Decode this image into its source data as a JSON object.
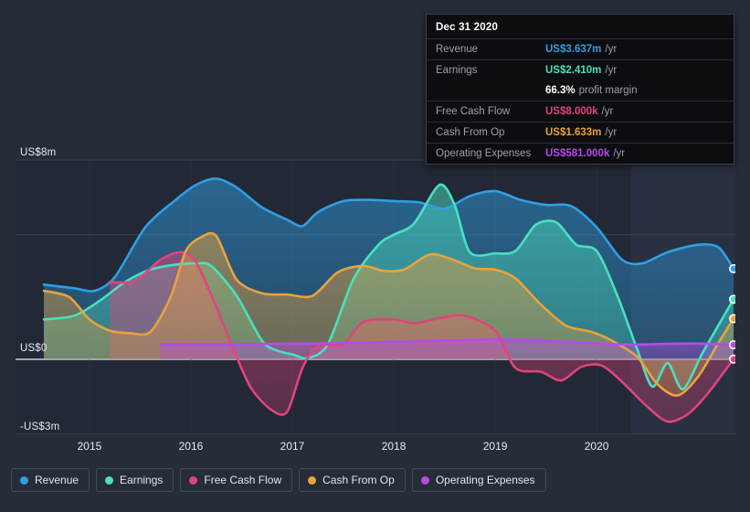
{
  "tooltip": {
    "title": "Dec 31 2020",
    "rows": [
      {
        "key": "Revenue",
        "value": "US$3.637m",
        "unit": "/yr",
        "color": "#2f9fe3"
      },
      {
        "key": "Earnings",
        "value": "US$2.410m",
        "unit": "/yr",
        "color": "#4ae0c0"
      },
      {
        "key": "",
        "value": "66.3%",
        "unit": "profit margin",
        "color": "#ffffff"
      },
      {
        "key": "Free Cash Flow",
        "value": "US$8.000k",
        "unit": "/yr",
        "color": "#e0447c"
      },
      {
        "key": "Cash From Op",
        "value": "US$1.633m",
        "unit": "/yr",
        "color": "#e8a33d"
      },
      {
        "key": "Operating Expenses",
        "value": "US$581.000k",
        "unit": "/yr",
        "color": "#b84ae8"
      }
    ]
  },
  "legend": {
    "items": [
      {
        "label": "Revenue",
        "color": "#2f9fe3"
      },
      {
        "label": "Earnings",
        "color": "#4ae0c0"
      },
      {
        "label": "Free Cash Flow",
        "color": "#e0447c"
      },
      {
        "label": "Cash From Op",
        "color": "#e8a33d"
      },
      {
        "label": "Operating Expenses",
        "color": "#b84ae8"
      }
    ]
  },
  "chart_data": {
    "type": "area",
    "title": "",
    "xlabel": "",
    "ylabel": "",
    "currency": "USD",
    "ylim": [
      -3,
      8
    ],
    "y_ticks": [
      {
        "label": "US$8m",
        "value": 8
      },
      {
        "label": "US$0",
        "value": 0
      },
      {
        "label": "-US$3m",
        "value": -3
      }
    ],
    "gridlines": [
      8,
      5,
      0,
      -3
    ],
    "x_ticks": [
      "2015",
      "2016",
      "2017",
      "2018",
      "2019",
      "2020"
    ],
    "x_range": [
      "2014-07",
      "2021-03"
    ],
    "grid": true,
    "legend_position": "bottom-left",
    "highlight_band": {
      "from": "2020-06",
      "to": "2021-03"
    },
    "series": [
      {
        "name": "Revenue",
        "color": "#2f9fe3",
        "end_value": 3.637,
        "points": [
          [
            2014.55,
            3.0
          ],
          [
            2014.85,
            2.85
          ],
          [
            2015.05,
            2.75
          ],
          [
            2015.25,
            3.3
          ],
          [
            2015.55,
            5.3
          ],
          [
            2015.85,
            6.4
          ],
          [
            2016.05,
            7.0
          ],
          [
            2016.25,
            7.25
          ],
          [
            2016.45,
            6.9
          ],
          [
            2016.7,
            6.1
          ],
          [
            2016.95,
            5.6
          ],
          [
            2017.1,
            5.35
          ],
          [
            2017.25,
            5.9
          ],
          [
            2017.5,
            6.35
          ],
          [
            2017.75,
            6.4
          ],
          [
            2018.0,
            6.35
          ],
          [
            2018.25,
            6.3
          ],
          [
            2018.5,
            6.05
          ],
          [
            2018.75,
            6.55
          ],
          [
            2019.0,
            6.75
          ],
          [
            2019.25,
            6.4
          ],
          [
            2019.5,
            6.2
          ],
          [
            2019.75,
            6.15
          ],
          [
            2020.0,
            5.3
          ],
          [
            2020.25,
            4.0
          ],
          [
            2020.45,
            3.85
          ],
          [
            2020.7,
            4.3
          ],
          [
            2021.0,
            4.6
          ],
          [
            2021.2,
            4.5
          ],
          [
            2021.35,
            3.637
          ]
        ]
      },
      {
        "name": "Earnings",
        "color": "#4ae0c0",
        "end_value": 2.41,
        "points": [
          [
            2014.55,
            1.6
          ],
          [
            2014.85,
            1.75
          ],
          [
            2015.1,
            2.35
          ],
          [
            2015.35,
            3.1
          ],
          [
            2015.6,
            3.6
          ],
          [
            2015.85,
            3.8
          ],
          [
            2016.05,
            3.85
          ],
          [
            2016.2,
            3.75
          ],
          [
            2016.45,
            2.55
          ],
          [
            2016.7,
            0.75
          ],
          [
            2016.85,
            0.35
          ],
          [
            2017.0,
            0.2
          ],
          [
            2017.15,
            0.05
          ],
          [
            2017.35,
            0.6
          ],
          [
            2017.6,
            3.2
          ],
          [
            2017.85,
            4.6
          ],
          [
            2018.0,
            5.0
          ],
          [
            2018.2,
            5.45
          ],
          [
            2018.45,
            7.0
          ],
          [
            2018.6,
            6.2
          ],
          [
            2018.75,
            4.3
          ],
          [
            2019.0,
            4.25
          ],
          [
            2019.2,
            4.35
          ],
          [
            2019.4,
            5.4
          ],
          [
            2019.6,
            5.5
          ],
          [
            2019.8,
            4.6
          ],
          [
            2020.0,
            4.35
          ],
          [
            2020.2,
            2.6
          ],
          [
            2020.4,
            0.4
          ],
          [
            2020.55,
            -1.1
          ],
          [
            2020.7,
            -0.15
          ],
          [
            2020.85,
            -1.2
          ],
          [
            2021.05,
            0.3
          ],
          [
            2021.35,
            2.41
          ]
        ]
      },
      {
        "name": "Free Cash Flow",
        "color": "#e0447c",
        "end_value": 0.008,
        "points": [
          [
            2015.2,
            3.1
          ],
          [
            2015.45,
            3.15
          ],
          [
            2015.7,
            4.0
          ],
          [
            2015.9,
            4.3
          ],
          [
            2016.05,
            3.9
          ],
          [
            2016.25,
            2.1
          ],
          [
            2016.45,
            0.1
          ],
          [
            2016.6,
            -1.2
          ],
          [
            2016.8,
            -2.05
          ],
          [
            2016.95,
            -2.1
          ],
          [
            2017.1,
            -0.35
          ],
          [
            2017.25,
            0.55
          ],
          [
            2017.5,
            0.6
          ],
          [
            2017.7,
            1.5
          ],
          [
            2018.0,
            1.6
          ],
          [
            2018.2,
            1.45
          ],
          [
            2018.45,
            1.65
          ],
          [
            2018.7,
            1.75
          ],
          [
            2019.0,
            1.15
          ],
          [
            2019.2,
            -0.35
          ],
          [
            2019.45,
            -0.5
          ],
          [
            2019.65,
            -0.85
          ],
          [
            2019.85,
            -0.3
          ],
          [
            2020.05,
            -0.25
          ],
          [
            2020.25,
            -0.9
          ],
          [
            2020.5,
            -1.9
          ],
          [
            2020.7,
            -2.5
          ],
          [
            2020.9,
            -2.2
          ],
          [
            2021.1,
            -1.35
          ],
          [
            2021.35,
            0.008
          ]
        ]
      },
      {
        "name": "Cash From Op",
        "color": "#e8a33d",
        "end_value": 1.633,
        "points": [
          [
            2014.55,
            2.75
          ],
          [
            2014.8,
            2.5
          ],
          [
            2015.0,
            1.6
          ],
          [
            2015.2,
            1.15
          ],
          [
            2015.4,
            1.05
          ],
          [
            2015.6,
            1.1
          ],
          [
            2015.8,
            2.5
          ],
          [
            2015.95,
            4.35
          ],
          [
            2016.1,
            4.9
          ],
          [
            2016.25,
            4.95
          ],
          [
            2016.45,
            3.2
          ],
          [
            2016.7,
            2.65
          ],
          [
            2016.95,
            2.6
          ],
          [
            2017.2,
            2.55
          ],
          [
            2017.45,
            3.5
          ],
          [
            2017.7,
            3.75
          ],
          [
            2017.9,
            3.55
          ],
          [
            2018.1,
            3.6
          ],
          [
            2018.35,
            4.2
          ],
          [
            2018.55,
            4.05
          ],
          [
            2018.8,
            3.65
          ],
          [
            2019.0,
            3.6
          ],
          [
            2019.2,
            3.25
          ],
          [
            2019.45,
            2.2
          ],
          [
            2019.7,
            1.35
          ],
          [
            2019.95,
            1.1
          ],
          [
            2020.15,
            0.75
          ],
          [
            2020.4,
            0.1
          ],
          [
            2020.6,
            -1.0
          ],
          [
            2020.8,
            -1.45
          ],
          [
            2021.0,
            -0.7
          ],
          [
            2021.2,
            0.65
          ],
          [
            2021.35,
            1.633
          ]
        ]
      },
      {
        "name": "Operating Expenses",
        "color": "#b84ae8",
        "end_value": 0.581,
        "points": [
          [
            2015.7,
            0.6
          ],
          [
            2016.0,
            0.6
          ],
          [
            2016.4,
            0.6
          ],
          [
            2016.8,
            0.62
          ],
          [
            2017.2,
            0.63
          ],
          [
            2017.6,
            0.66
          ],
          [
            2018.0,
            0.7
          ],
          [
            2018.4,
            0.74
          ],
          [
            2018.8,
            0.78
          ],
          [
            2019.0,
            0.8
          ],
          [
            2019.3,
            0.78
          ],
          [
            2019.6,
            0.72
          ],
          [
            2019.9,
            0.66
          ],
          [
            2020.2,
            0.6
          ],
          [
            2020.5,
            0.6
          ],
          [
            2020.8,
            0.63
          ],
          [
            2021.05,
            0.63
          ],
          [
            2021.35,
            0.581
          ]
        ]
      }
    ]
  }
}
